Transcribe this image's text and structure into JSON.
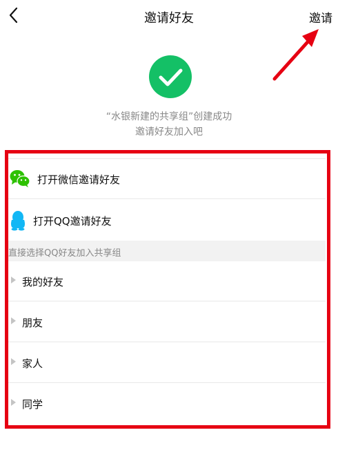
{
  "header": {
    "title": "邀请好友",
    "invite_label": "邀请",
    "back_icon": "chevron-left-icon"
  },
  "success": {
    "icon": "check-circle-icon",
    "icon_color": "#14c066",
    "line1": "“水银新建的共享组”创建成功",
    "line2": "邀请好友加入吧"
  },
  "share": {
    "wechat": {
      "label": "打开微信邀请好友",
      "icon": "wechat-icon",
      "color": "#2dc100"
    },
    "qq": {
      "label": "打开QQ邀请好友",
      "icon": "qq-icon",
      "color": "#12b7f5"
    }
  },
  "section": {
    "title": "直接选择QQ好友加入共享组"
  },
  "groups": [
    {
      "label": "我的好友"
    },
    {
      "label": "朋友"
    },
    {
      "label": "家人"
    },
    {
      "label": "同学"
    }
  ],
  "annotation_color": "#e60012"
}
